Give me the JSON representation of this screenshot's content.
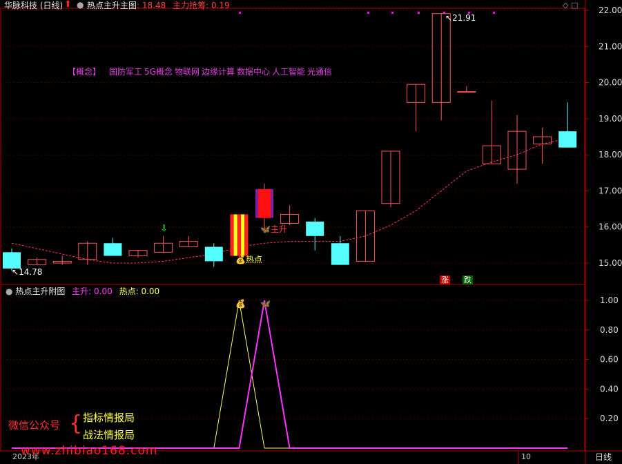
{
  "header": {
    "title": "华脉科技 (日线)",
    "indicator_label": "热点主升主图",
    "indicator_value_sep": ":",
    "indicator_value": "18.48",
    "secondary_label": "主力抢筹:",
    "secondary_value": "0.19",
    "window_controls": "◇ □"
  },
  "concept": {
    "tag": "【概念】",
    "keywords": [
      "国防军工",
      "5G概念",
      "物联网",
      "边缘计算",
      "数据中心",
      "人工智能",
      "光通信"
    ]
  },
  "annotations": {
    "high_label": "21.91",
    "low_label": "14.78",
    "hot_label": "热点",
    "rise_label": "主升",
    "zhang": "涨",
    "die": "跌"
  },
  "sub_panel": {
    "title": "热点主升附图",
    "zhusheng_label": "主升:",
    "zhusheng_value": "0.00",
    "redian_label": "热点:",
    "redian_value": "0.00"
  },
  "watermark": {
    "left": "微信公众号",
    "line1": "指标情报局",
    "line2": "战法情报局",
    "website": "www.zhibiao168.com"
  },
  "footer": {
    "year": "2023年",
    "tick": "10",
    "period": "日线"
  },
  "colors": {
    "up": "#ff5555",
    "down": "#55ffff",
    "ma": "#ff3366",
    "axis": "#b00000",
    "hot_line": "#ffff66",
    "rise_line": "#ff33ff"
  },
  "chart_data": {
    "type": "candlestick",
    "price_axis": {
      "ylim": [
        14.7,
        22.2
      ],
      "ticks": [
        15.0,
        16.0,
        17.0,
        18.0,
        19.0,
        20.0,
        21.0,
        22.0
      ]
    },
    "candles": [
      {
        "o": 15.3,
        "h": 15.4,
        "l": 14.78,
        "c": 14.85
      },
      {
        "o": 14.95,
        "h": 15.15,
        "l": 14.95,
        "c": 15.1
      },
      {
        "o": 15.0,
        "h": 15.2,
        "l": 14.95,
        "c": 15.05
      },
      {
        "o": 15.1,
        "h": 15.6,
        "l": 14.95,
        "c": 15.55
      },
      {
        "o": 15.55,
        "h": 15.7,
        "l": 15.2,
        "c": 15.2
      },
      {
        "o": 15.2,
        "h": 15.35,
        "l": 15.15,
        "c": 15.35
      },
      {
        "o": 15.3,
        "h": 15.75,
        "l": 15.3,
        "c": 15.55
      },
      {
        "o": 15.45,
        "h": 15.75,
        "l": 15.45,
        "c": 15.6
      },
      {
        "o": 15.45,
        "h": 15.55,
        "l": 14.9,
        "c": 15.05
      },
      {
        "o": 15.2,
        "h": 16.35,
        "l": 15.15,
        "c": 16.35,
        "special": "hot"
      },
      {
        "o": 16.25,
        "h": 17.2,
        "l": 15.9,
        "c": 17.05,
        "special": "rise"
      },
      {
        "o": 16.1,
        "h": 16.6,
        "l": 16.05,
        "c": 16.35
      },
      {
        "o": 16.15,
        "h": 16.25,
        "l": 15.35,
        "c": 15.75
      },
      {
        "o": 15.55,
        "h": 15.75,
        "l": 14.95,
        "c": 14.95
      },
      {
        "o": 15.05,
        "h": 16.45,
        "l": 15.05,
        "c": 16.45
      },
      {
        "o": 16.65,
        "h": 18.1,
        "l": 16.55,
        "c": 18.1
      },
      {
        "o": 19.45,
        "h": 19.95,
        "l": 18.65,
        "c": 19.95
      },
      {
        "o": 19.45,
        "h": 21.91,
        "l": 18.95,
        "c": 21.91
      },
      {
        "o": 19.75,
        "h": 19.9,
        "l": 19.75,
        "c": 19.75
      },
      {
        "o": 17.75,
        "h": 19.5,
        "l": 17.75,
        "c": 18.25
      },
      {
        "o": 17.6,
        "h": 19.1,
        "l": 17.2,
        "c": 18.65
      },
      {
        "o": 18.3,
        "h": 18.75,
        "l": 17.75,
        "c": 18.5
      },
      {
        "o": 18.65,
        "h": 19.45,
        "l": 18.2,
        "c": 18.2
      }
    ],
    "ma": [
      15.55,
      15.4,
      15.25,
      15.1,
      15.0,
      15.0,
      15.05,
      15.15,
      15.25,
      15.45,
      15.55,
      15.6,
      15.6,
      15.6,
      15.75,
      16.05,
      16.45,
      17.0,
      17.55,
      17.8,
      18.0,
      18.3,
      18.45
    ],
    "sub_axis": {
      "ylim": [
        0,
        1.07
      ],
      "ticks": [
        0.2,
        0.4,
        0.6,
        0.8,
        1.0
      ]
    },
    "series": [
      {
        "name": "热点",
        "values": [
          0,
          0,
          0,
          0,
          0,
          0,
          0,
          0,
          0,
          1,
          0,
          0,
          0,
          0,
          0,
          0,
          0,
          0,
          0,
          0,
          0,
          0,
          0
        ]
      },
      {
        "name": "主升",
        "values": [
          0,
          0,
          0,
          0,
          0,
          0,
          0,
          0,
          0,
          0,
          1,
          0,
          0,
          0,
          0,
          0,
          0,
          0,
          0,
          0,
          0,
          0,
          0
        ]
      }
    ]
  }
}
